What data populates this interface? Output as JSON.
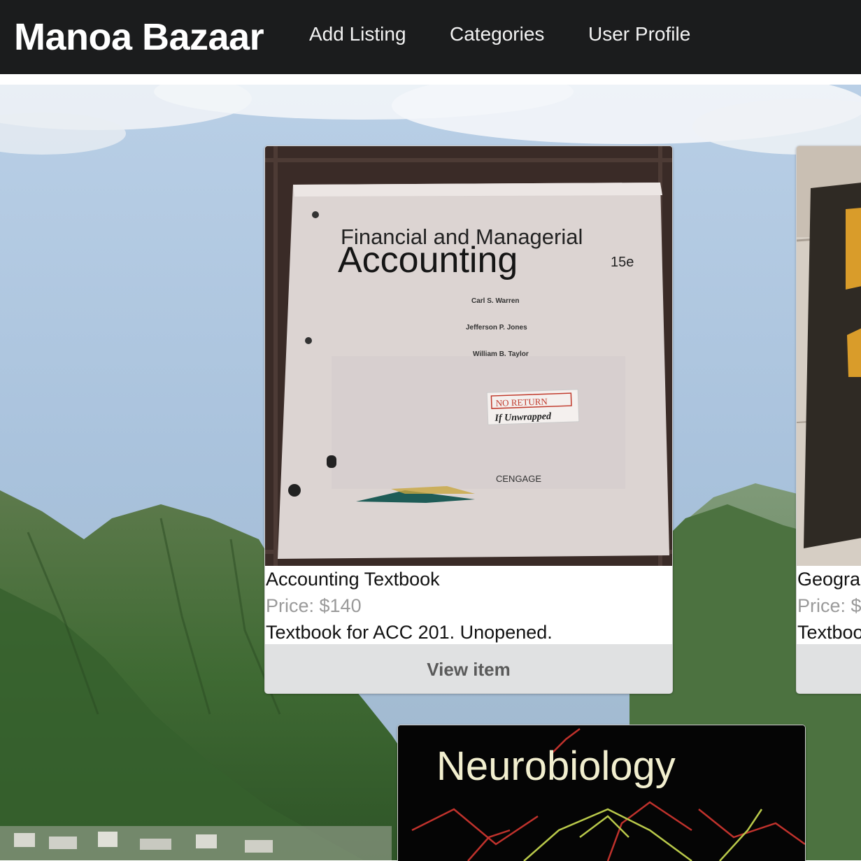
{
  "navbar": {
    "brand": "Manoa Bazaar",
    "links": [
      "Add Listing",
      "Categories",
      "User Profile"
    ]
  },
  "listings": [
    {
      "title": "Accounting Textbook",
      "price": "Price: $140",
      "description": "Textbook for ACC 201. Unopened.",
      "button": "View item",
      "cover": {
        "title_line1": "Financial and Managerial",
        "title_line2": "Accounting",
        "edition": "15e",
        "author1": "Carl S. Warren",
        "author2": "Jefferson P. Jones",
        "author3": "William B. Taylor",
        "sticker_line1": "NO RETURN",
        "sticker_line2": "If Unwrapped",
        "publisher": "CENGAGE"
      }
    },
    {
      "title": "Geogra",
      "price": "Price: $",
      "description": "Textboo"
    },
    {
      "cover_title": "Neurobiology"
    }
  ],
  "colors": {
    "navbar_bg": "#1b1c1d",
    "button_bg": "#e0e1e2",
    "price_text": "#9a9a9a"
  }
}
